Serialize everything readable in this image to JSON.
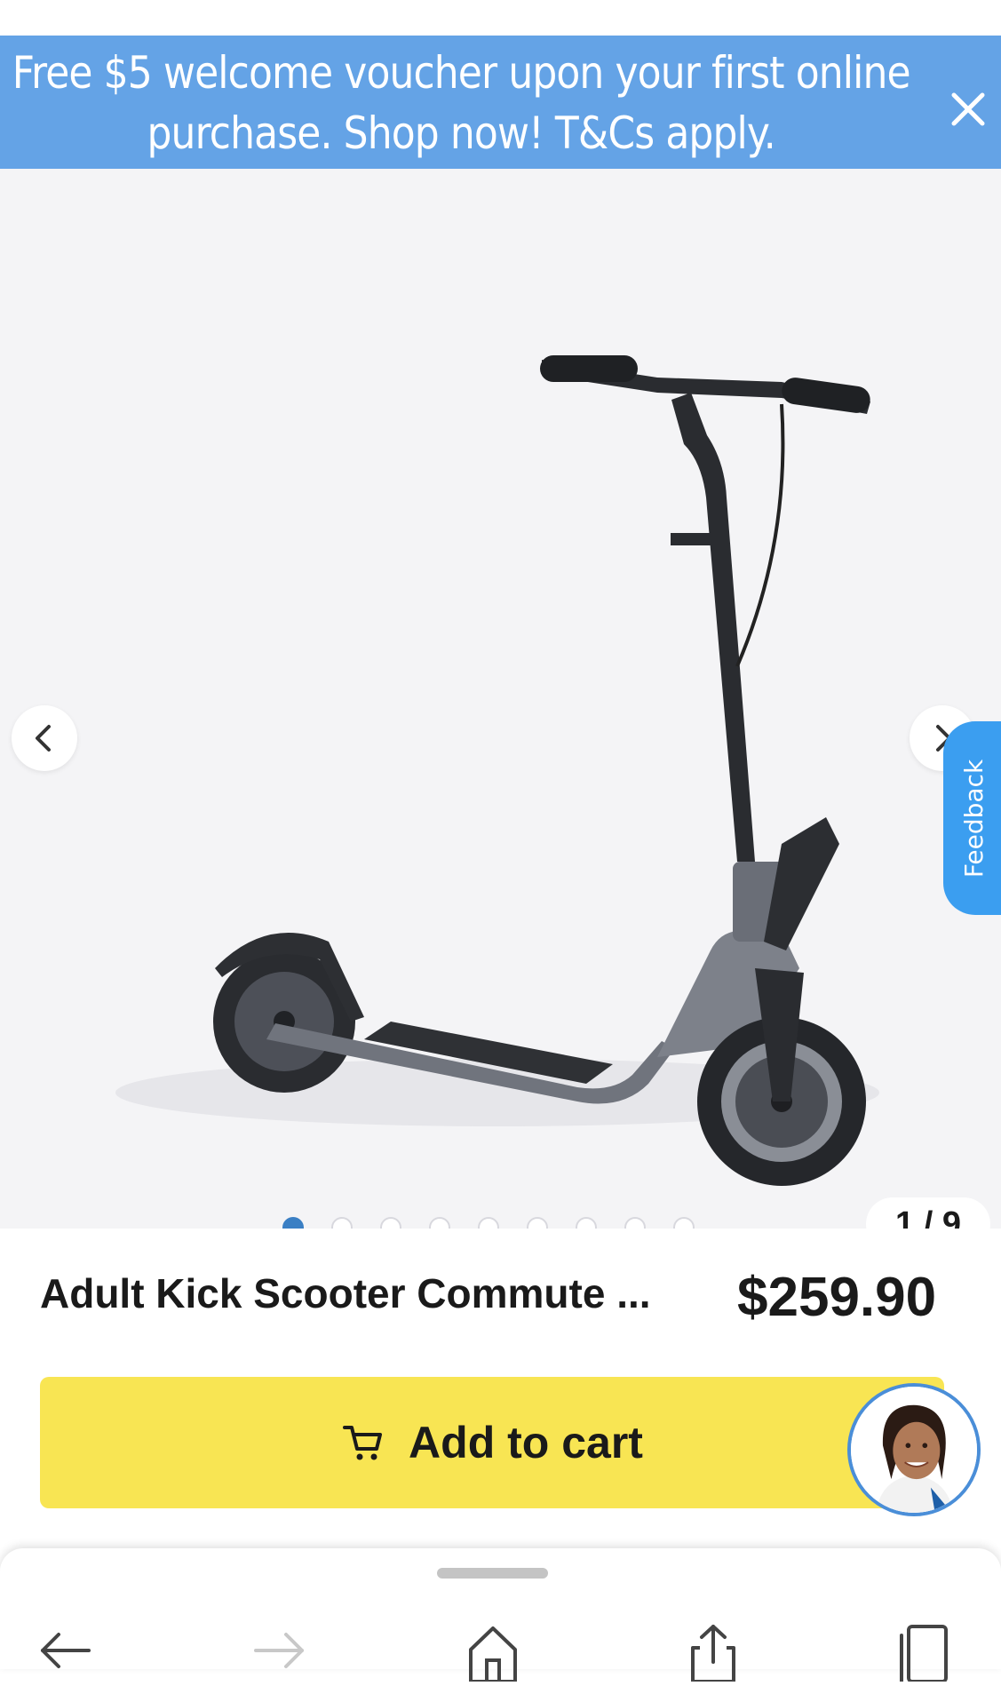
{
  "promo": {
    "text_line1": "Free $5 welcome voucher upon your first online",
    "text_line2": "purchase. Shop now! T&Cs apply.",
    "close_icon": "close-icon"
  },
  "gallery": {
    "image": "kick-scooter-product-image",
    "prev_icon": "chevron-left-icon",
    "next_icon": "chevron-right-icon",
    "counter": "1 / 9",
    "total_images": 9,
    "active_index": 1
  },
  "feedback": {
    "label": "Feedback"
  },
  "product": {
    "title": "Adult Kick Scooter Commute ...",
    "price": "$259.90"
  },
  "cart": {
    "label": "Add to cart",
    "icon": "cart-icon"
  },
  "assistant": {
    "icon": "assistant-avatar"
  },
  "browser_nav": {
    "icons": [
      "back-arrow-icon",
      "forward-arrow-icon",
      "home-icon",
      "share-icon",
      "tabs-icon"
    ]
  },
  "colors": {
    "banner": "#64a3e6",
    "cta": "#f8e553",
    "feedback": "#3b9ef0",
    "active_dot": "#3a7fc4"
  }
}
